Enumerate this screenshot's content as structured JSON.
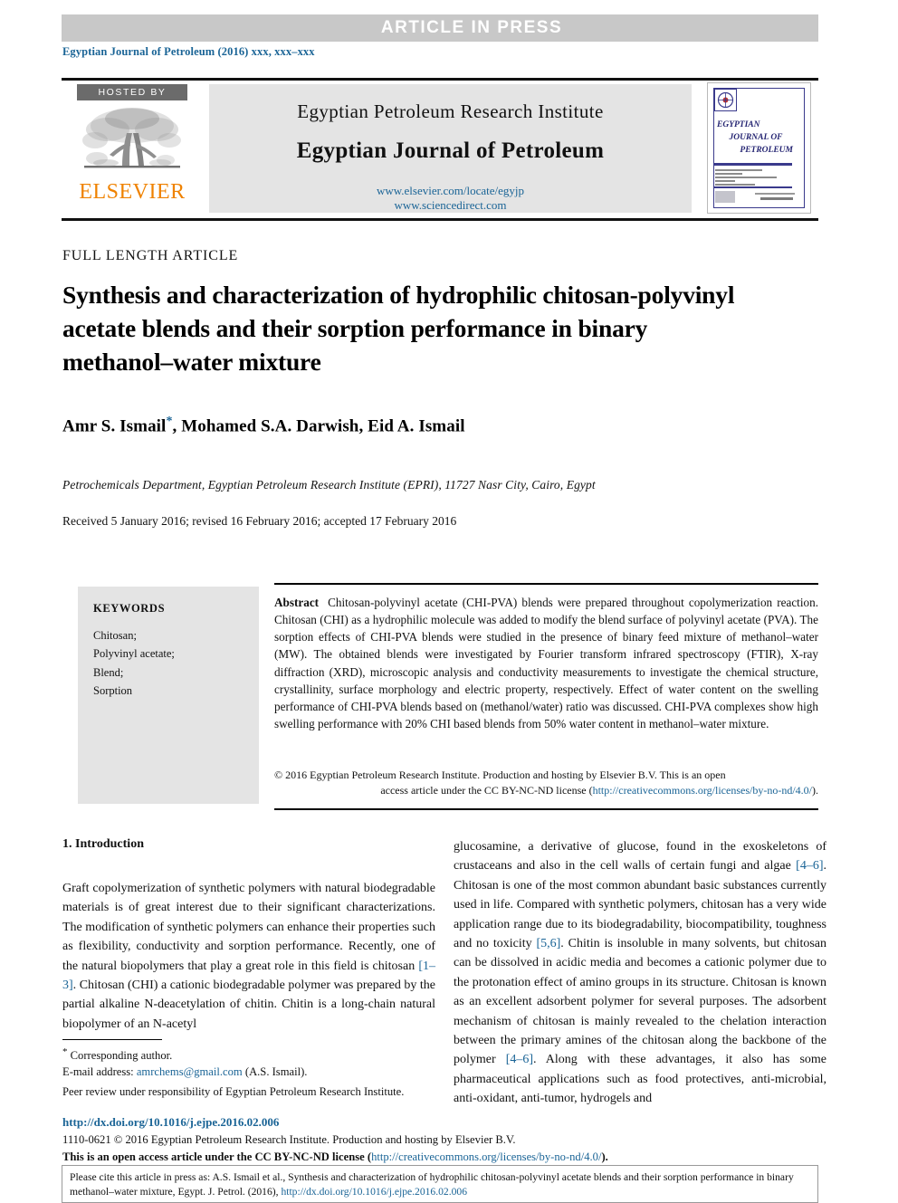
{
  "banner": {
    "text": "ARTICLE  IN  PRESS"
  },
  "journal_ref": "Egyptian Journal of Petroleum (2016) xxx, xxx–xxx",
  "masthead": {
    "hosted_by": "HOSTED BY",
    "publisher": "ELSEVIER",
    "institute": "Egyptian Petroleum Research Institute",
    "journal": "Egyptian Journal of Petroleum",
    "url_elsevier": "www.elsevier.com/locate/egyjp",
    "url_sciencedirect": "www.sciencedirect.com",
    "cover": {
      "line1": "EGYPTIAN",
      "line2": "JOURNAL OF",
      "line3": "PETROLEUM"
    }
  },
  "article": {
    "type": "FULL LENGTH ARTICLE",
    "title": "Synthesis and characterization of hydrophilic chitosan-polyvinyl acetate blends and their sorption performance in binary methanol–water mixture",
    "authors": "Amr S. Ismail",
    "authors_rest": ", Mohamed S.A. Darwish, Eid A. Ismail",
    "corresponding_mark": "*",
    "affiliation": "Petrochemicals Department, Egyptian Petroleum Research Institute (EPRI), 11727 Nasr City, Cairo, Egypt",
    "dates": "Received 5 January 2016; revised 16 February 2016; accepted 17 February 2016"
  },
  "keywords": {
    "heading": "KEYWORDS",
    "list": "Chitosan;\nPolyvinyl acetate;\nBlend;\nSorption"
  },
  "abstract": {
    "label": "Abstract",
    "text": "Chitosan-polyvinyl acetate (CHI-PVA) blends were prepared throughout copolymerization reaction. Chitosan (CHI) as a hydrophilic molecule was added to modify the blend surface of polyvinyl acetate (PVA). The sorption effects of CHI-PVA blends were studied in the presence of binary feed mixture of methanol–water (MW). The obtained blends were investigated by Fourier transform infrared spectroscopy (FTIR), X-ray diffraction (XRD), microscopic analysis and conductivity measurements to investigate the chemical structure, crystallinity, surface morphology and electric property, respectively. Effect of water content on the swelling performance of CHI-PVA blends based on (methanol/water) ratio was discussed. CHI-PVA complexes show high swelling performance with 20% CHI based blends from 50% water content in methanol–water mixture.",
    "copyright_line1": "© 2016 Egyptian Petroleum Research Institute. Production and hosting by Elsevier B.V.  This is an open",
    "copyright_line2_pre": "access article under the CC BY-NC-ND license (",
    "copyright_license_url": "http://creativecommons.org/licenses/by-no-nd/4.0/",
    "copyright_line2_post": ")."
  },
  "introduction": {
    "heading": "1. Introduction",
    "left_text_a": "Graft copolymerization of synthetic polymers with natural biodegradable materials is of great interest due to their significant characterizations. The modification of synthetic polymers can enhance their properties such as flexibility, conductivity and sorption performance. Recently, one of the natural biopolymers that play a great role in this field is chitosan ",
    "left_ref_1": "[1–3]",
    "left_text_b": ". Chitosan (CHI) a cationic biodegradable polymer was prepared by the partial alkaline N-deacetylation of chitin. Chitin is a long-chain natural biopolymer of an N-acetyl",
    "right_text_a": "glucosamine, a derivative of glucose, found in the exoskeletons of crustaceans and also in the cell walls of certain fungi and algae ",
    "right_ref_1": "[4–6]",
    "right_text_b": ". Chitosan is one of the most common abundant basic substances currently used in life. Compared with synthetic polymers, chitosan has a very wide application range due to its biodegradability, biocompatibility, toughness and no toxicity ",
    "right_ref_2": "[5,6]",
    "right_text_c": ". Chitin is insoluble in many solvents, but chitosan can be dissolved in acidic media and becomes a cationic polymer due to the protonation effect of amino groups in its structure. Chitosan is known as an excellent adsorbent polymer for several purposes. The adsorbent mechanism of chitosan is mainly revealed to the chelation interaction between the primary amines of the chitosan along the backbone of the polymer ",
    "right_ref_3": "[4–6]",
    "right_text_d": ". Along with these advantages, it also has some pharmaceutical applications such as food protectives, anti-microbial, anti-oxidant, anti-tumor, hydrogels and"
  },
  "footnote": {
    "corresponding": "Corresponding author.",
    "email_label": "E-mail address:",
    "email": "amrchems@gmail.com",
    "email_suffix": "(A.S. Ismail).",
    "peer_review": "Peer review under responsibility of Egyptian Petroleum Research Institute."
  },
  "footer": {
    "doi": "http://dx.doi.org/10.1016/j.ejpe.2016.02.006",
    "issn_line": "1110-0621 © 2016 Egyptian Petroleum Research Institute. Production and hosting by Elsevier B.V.",
    "license_pre": "This is an open access article under the CC BY-NC-ND license (",
    "license_url": "http://creativecommons.org/licenses/by-no-nd/4.0/",
    "license_post": ")."
  },
  "cite_box": {
    "text_pre": "Please cite this article in press as: A.S. Ismail et al., Synthesis and characterization of hydrophilic chitosan-polyvinyl acetate blends and their sorption performance in binary methanol–water mixture,  Egypt. J. Petrol. (2016), ",
    "url": "http://dx.doi.org/10.1016/j.ejpe.2016.02.006"
  },
  "colors": {
    "link": "#1a6496",
    "elsevier_orange": "#ef8200",
    "banner_bg": "#c8c8c8",
    "panel_gray": "#e4e4e4"
  }
}
